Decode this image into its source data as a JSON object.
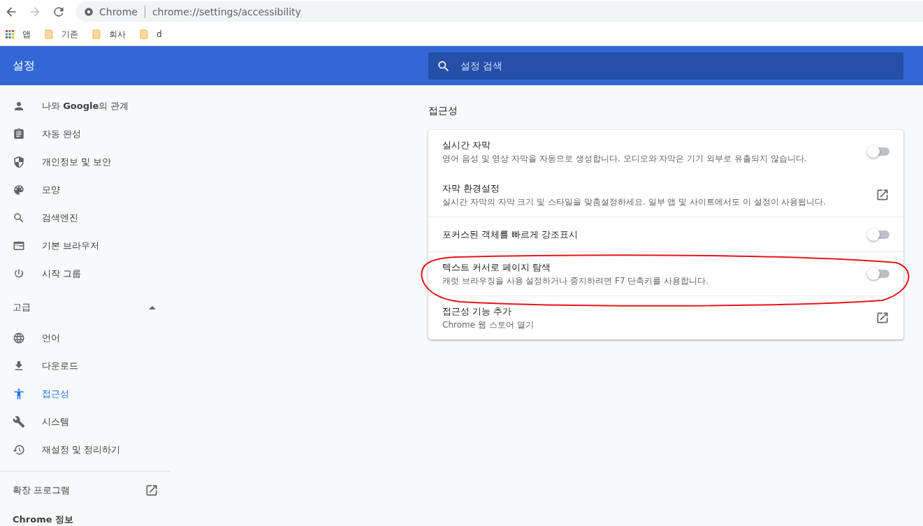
{
  "browser": {
    "site_label": "Chrome",
    "url": "chrome://settings/accessibility"
  },
  "bookmarks": [
    {
      "kind": "apps",
      "label": "앱"
    },
    {
      "kind": "folder",
      "label": "기존"
    },
    {
      "kind": "folder",
      "label": "회사"
    },
    {
      "kind": "folder",
      "label": "d"
    }
  ],
  "header": {
    "title": "설정",
    "search": {
      "placeholder": "설정 검색"
    }
  },
  "sidebar": {
    "items": [
      {
        "label": "나와 **Google**의 관계",
        "selected": false
      },
      {
        "label": "자동 완성",
        "selected": false
      },
      {
        "label": "개인정보 및 보안",
        "selected": false
      },
      {
        "label": "모양",
        "selected": false
      },
      {
        "label": "검색엔진",
        "selected": false
      },
      {
        "label": "기본 브라우저",
        "selected": false
      },
      {
        "label": "시작 그룹",
        "selected": false
      }
    ],
    "advanced": {
      "label": "고급",
      "expanded": true,
      "items": [
        {
          "label": "언어",
          "selected": false
        },
        {
          "label": "다운로드",
          "selected": false
        },
        {
          "label": "접근성",
          "selected": true
        },
        {
          "label": "시스템",
          "selected": false
        },
        {
          "label": "재설정 및 정리하기",
          "selected": false
        }
      ]
    },
    "extensions": {
      "label": "확장 프로그램"
    },
    "about": {
      "label": "Chrome 정보"
    }
  },
  "section": {
    "title": "접근성",
    "rows": [
      {
        "kind": "toggle",
        "title": "실시간 자막",
        "description": "영어 음성 및 영상 자막을 자동으로 생성합니다. 오디오와 자막은 기기 외부로 유출되지 않습니다.",
        "on": false
      },
      {
        "kind": "link",
        "title": "자막 환경설정",
        "description": "실시간 자막의 자막 크기 및 스타일을 맞춤설정하세요. 일부 앱 및 사이트에서도 이 설정이 사용됩니다."
      },
      {
        "kind": "toggle",
        "title": "포커스된 객체를 빠르게 강조표시",
        "on": false
      },
      {
        "kind": "toggle",
        "title": "텍스트 커서로 페이지 탐색",
        "description": "캐럿 브라우징을 사용 설정하거나 중지하려면 F7 단축키를 사용합니다.",
        "on": false
      },
      {
        "kind": "link",
        "title": "접근성 기능 추가",
        "description": "Chrome 웹 스토어 열기"
      }
    ]
  }
}
